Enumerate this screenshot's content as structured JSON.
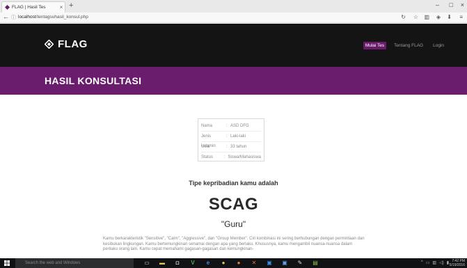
{
  "browser": {
    "tab_title": "FLAG | Hasil Tes",
    "url_host": "localhost",
    "url_path": "/tentagsuhasil_konsul.php"
  },
  "site": {
    "logo_text": "FLAG",
    "nav": [
      "Mulai Tes",
      "Tentang FLAG",
      "Login"
    ],
    "active_nav": "Mulai Tes",
    "banner_title": "HASIL KONSULTASI"
  },
  "profile": [
    {
      "label": "Nama",
      "value": "ASD DFG"
    },
    {
      "label": "Jenis kelamin",
      "value": "Laki-laki"
    },
    {
      "label": "Usia",
      "value": "33 tahun"
    },
    {
      "label": "Status",
      "value": "Siswa/Mahasiswa"
    }
  ],
  "result": {
    "heading": "Tipe kepribadian kamu adalah",
    "code": "SCAG",
    "nickname": "\"Guru\"",
    "description": "Kamu berkarakteristik \"Sensitive\", \"Calm\", \"Aggressive\", dan \"Group Member\". Ciri kombinasi ini sering berhubungan dengan permintaan dan kesibukan lingkungan. Kamu bertemungkinan senamai dengan apa yang berlaku. Khususnya, kamu mengambil nuansa-nuansa dalam perilaku orang lain. Kamu cepat memahami gagasan-gagasan dan kemungkinan-"
  },
  "taskbar": {
    "search_placeholder": "Search the web and Windows",
    "time": "7:42 PM",
    "date": "5/19/2016"
  },
  "colors": {
    "header_bg": "#141414",
    "banner_bg": "#6a1d6c",
    "accent": "#6a1a6a"
  }
}
